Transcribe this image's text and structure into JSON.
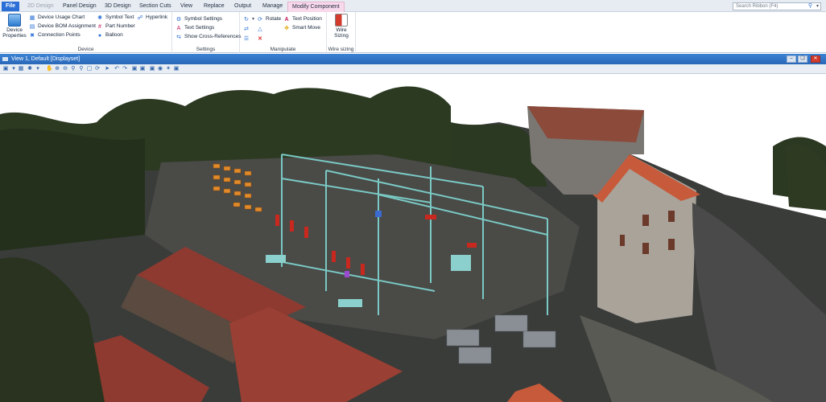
{
  "tabs": [
    {
      "label": "File"
    },
    {
      "label": "2D Design"
    },
    {
      "label": "Panel Design"
    },
    {
      "label": "3D Design"
    },
    {
      "label": "Section Cuts"
    },
    {
      "label": "View"
    },
    {
      "label": "Replace"
    },
    {
      "label": "Output"
    },
    {
      "label": "Manage"
    },
    {
      "label": "Modify Component"
    }
  ],
  "search": {
    "placeholder": "Search Ribbon (F4)"
  },
  "ribbon": {
    "device": {
      "label": "Device",
      "properties": "Device Properties",
      "usage_chart": "Device Usage Chart",
      "bom_assignment": "Device BOM Assignment",
      "connection_points": "Connection Points",
      "symbol_text": "Symbol Text",
      "part_number": "Part Number",
      "balloon": "Balloon",
      "hyperlink": "Hyperlink"
    },
    "settings": {
      "label": "Settings",
      "symbol_settings": "Symbol Settings",
      "text_settings": "Text Settings",
      "show_cross_references": "Show Cross-References"
    },
    "manipulate": {
      "label": "Manipulate",
      "rotate": "Rotate",
      "text_position": "Text Position",
      "smart_move": "Smart Move"
    },
    "wire_sizing": {
      "label": "Wire sizing",
      "button": "Wire Sizing"
    }
  },
  "view": {
    "title": "View 1, Default [Displayset]"
  },
  "colors": {
    "accent": "#2b6fd6",
    "contextual_tab": "#f9d9ec",
    "view_title": "#3b82d4",
    "roof": "#9a3f33",
    "orange_roof": "#c65a3a"
  }
}
